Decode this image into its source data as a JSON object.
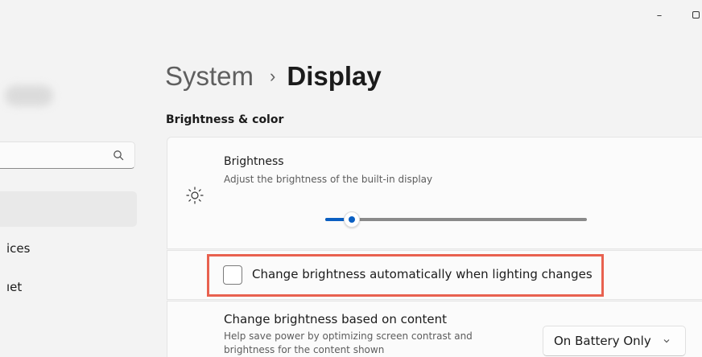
{
  "window": {
    "minimize_glyph": "–"
  },
  "sidebar": {
    "search": {
      "icon": "search-icon"
    },
    "items": [
      {
        "label": "ices"
      },
      {
        "label": "ıet"
      }
    ]
  },
  "breadcrumb": {
    "parent": "System",
    "separator": "›",
    "current": "Display"
  },
  "section": {
    "title": "Brightness & color"
  },
  "brightness": {
    "icon": "sun-icon",
    "title": "Brightness",
    "description": "Adjust the brightness of the built-in display",
    "level": 0.1,
    "accent_color": "#0a5fc2"
  },
  "auto_brightness": {
    "label": "Change brightness automatically when lighting changes",
    "checked": false,
    "highlight_color": "#e8614f"
  },
  "content_brightness": {
    "title": "Change brightness based on content",
    "description": "Help save power by optimizing screen contrast and brightness for the content shown",
    "selected": "On Battery Only"
  }
}
